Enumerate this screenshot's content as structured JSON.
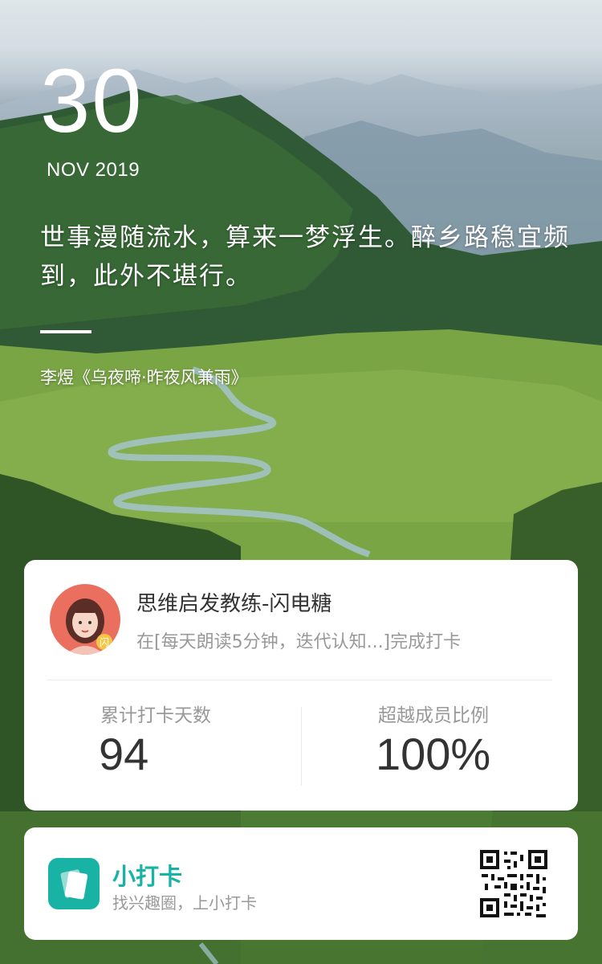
{
  "date": {
    "day": "30",
    "month_year": "NOV 2019"
  },
  "poem": {
    "text": "世事漫随流水，算来一梦浮生。醉乡路稳宜频到，此外不堪行。",
    "author": "李煜《乌夜啼·昨夜风兼雨》"
  },
  "profile": {
    "username": "思维启发教练-闪电糖",
    "checkin_text": "在[每天朗读5分钟，迭代认知...]完成打卡"
  },
  "stats": [
    {
      "label": "累计打卡天数",
      "value": "94"
    },
    {
      "label": "超越成员比例",
      "value": "100%"
    }
  ],
  "app": {
    "name": "小打卡",
    "slogan": "找兴趣圈，上小打卡"
  },
  "colors": {
    "accent": "#19b3a5"
  }
}
